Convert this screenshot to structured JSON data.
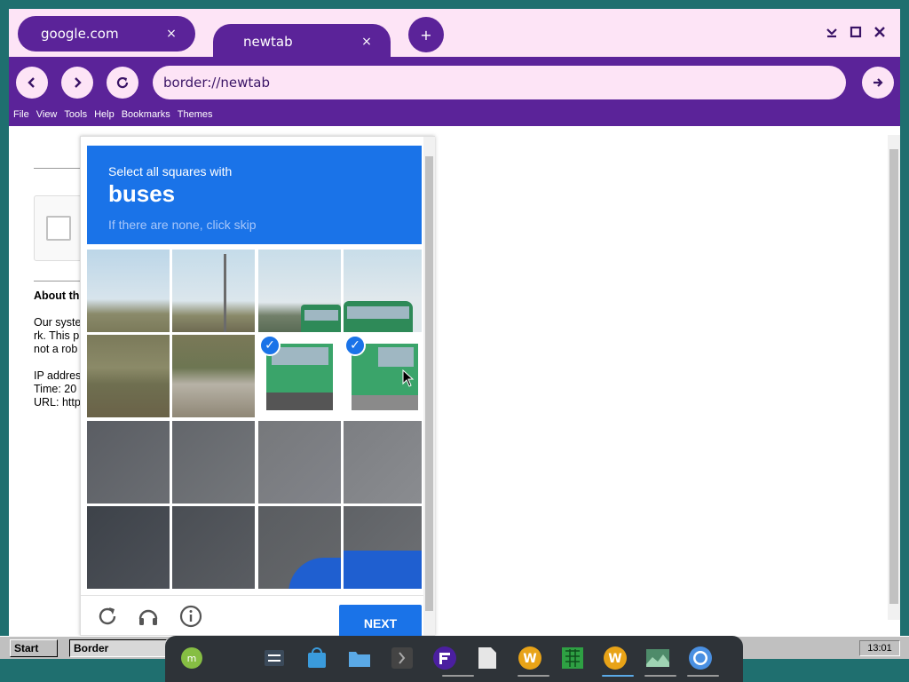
{
  "browser": {
    "tabs": [
      {
        "label": "google.com",
        "close": "×"
      },
      {
        "label": "newtab",
        "close": "×"
      }
    ],
    "new_tab": "+",
    "url": "border://newtab",
    "menu": [
      "File",
      "View",
      "Tools",
      "Help",
      "Bookmarks",
      "Themes"
    ]
  },
  "page": {
    "about": "About th",
    "lines": [
      "Our syste",
      "rk. This p",
      "not a rob"
    ],
    "meta": [
      "IP addres",
      "Time: 20",
      "URL: http"
    ]
  },
  "captcha": {
    "prompt": "Select all squares with",
    "target": "buses",
    "hint": "If there are none, click skip",
    "next": "NEXT",
    "selected_tiles": [
      6,
      7
    ]
  },
  "taskbar": {
    "start": "Start",
    "task": "Border",
    "clock": "13:01"
  },
  "colors": {
    "browser_purple": "#5b2399",
    "browser_pink": "#fde4f6",
    "captcha_blue": "#1a73e8"
  }
}
